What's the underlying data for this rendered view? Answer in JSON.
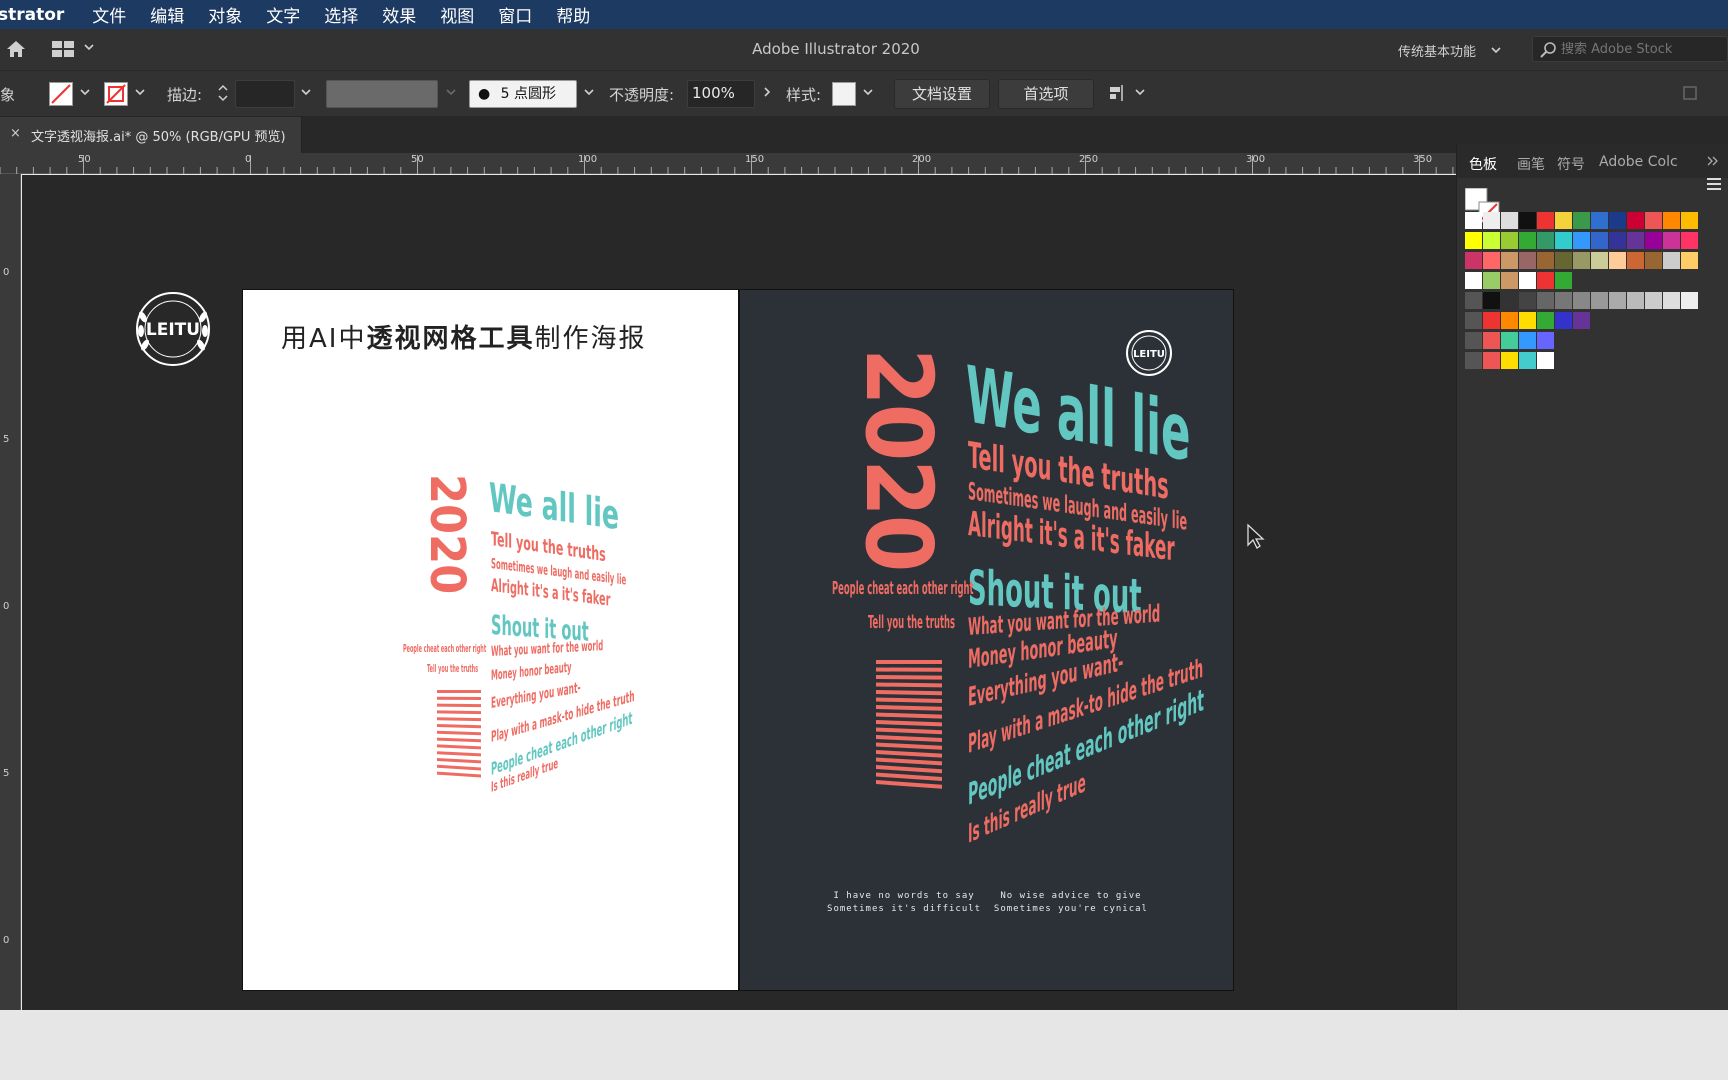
{
  "menubar": {
    "app_name": "strator",
    "items": [
      "文件",
      "编辑",
      "对象",
      "文字",
      "选择",
      "效果",
      "视图",
      "窗口",
      "帮助"
    ]
  },
  "appbar": {
    "title": "Adobe Illustrator 2020",
    "workspace": "传统基本功能",
    "search_placeholder": "搜索 Adobe Stock"
  },
  "control": {
    "left_glyph": "象",
    "stroke_label": "描边:",
    "brush": "5 点圆形",
    "opacity_label": "不透明度:",
    "opacity_value": "100%",
    "style_label": "样式:",
    "doc_setup": "文档设置",
    "preferences": "首选项"
  },
  "tab": {
    "close": "×",
    "name": "文字透视海报.ai* @ 50% (RGB/GPU 预览)"
  },
  "ruler": {
    "h_labels": [
      "50",
      "0",
      "50",
      "100",
      "150",
      "200",
      "250",
      "300",
      "350"
    ],
    "v_labels": [
      "0",
      "5",
      "0",
      "5",
      "0"
    ]
  },
  "poster": {
    "heading_pre": "用AI中",
    "heading_bold": "透视网格工具",
    "heading_post": "制作海报",
    "logo": "LEITU",
    "year": "2020",
    "line1": "We all lie",
    "line2": "Tell you the truths",
    "line3": "Sometimes we laugh and easily lie",
    "line4": "Alright it's a it's faker",
    "line5": "Shout it out",
    "line6": "What you want for the world",
    "line7": "Money honor beauty",
    "line8": "Everything you want-",
    "line9": "Play with a mask-to hide the truth",
    "line10": "People cheat each other right",
    "line11": "Is this really true",
    "side1": "People cheat each other right",
    "side2": "Tell you the truths",
    "footer1": "I have no words to say    No wise advice to give",
    "footer2": "Sometimes it's difficult  Sometimes you're cynical"
  },
  "panel": {
    "tabs": [
      "色板",
      "画笔",
      "符号",
      "Adobe Colc"
    ]
  },
  "colors": {
    "teal": "#63c7c1",
    "coral": "#ef6c63",
    "menubar": "#1d3a63",
    "poster_dark": "#2c3138"
  }
}
